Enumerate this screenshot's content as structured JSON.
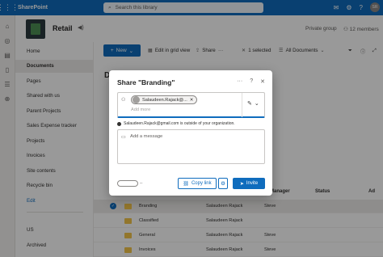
{
  "suite": {
    "app_name": "SharePoint",
    "search_placeholder": "Search this library",
    "avatar_initials": "SR"
  },
  "site": {
    "title": "Retail",
    "group_type": "Private group",
    "members": "12 members"
  },
  "leftnav": {
    "items": [
      {
        "label": "Home"
      },
      {
        "label": "Documents"
      },
      {
        "label": "Pages"
      },
      {
        "label": "Shared with us"
      },
      {
        "label": "Parent Projects"
      },
      {
        "label": "Sales Expense tracker"
      },
      {
        "label": "Projects"
      },
      {
        "label": "Invoices"
      },
      {
        "label": "Site contents"
      },
      {
        "label": "Recycle bin"
      },
      {
        "label": "Edit"
      },
      {
        "label": "US"
      },
      {
        "label": "Archived"
      }
    ],
    "active": "Documents"
  },
  "commandbar": {
    "new_label": "New",
    "edit_grid": "Edit in grid view",
    "share": "Share",
    "selected": "1 selected",
    "view": "All Documents"
  },
  "library": {
    "title_fragment": "D",
    "columns": {
      "manager": "ct Manager",
      "status": "Status",
      "ad": "Ad"
    },
    "rows": [
      {
        "name": "Branding",
        "modified_by": "Salaudeen Rajack",
        "manager": "Steve",
        "selected": true
      },
      {
        "name": "Classified",
        "modified_by": "Salaudeen Rajack",
        "manager": "",
        "selected": false
      },
      {
        "name": "General",
        "modified_by": "Salaudeen Rajack",
        "manager": "Steve",
        "selected": false
      },
      {
        "name": "Invoices",
        "modified_by": "Salaudeen Rajack",
        "manager": "Steve",
        "selected": false
      }
    ]
  },
  "share_dialog": {
    "title": "Share \"Branding\"",
    "recipient": "Salaudeen.Rajack@...",
    "add_more_placeholder": "Add more",
    "warning": "Salaudeen.Rajack@gmail.com is outside of your organization.",
    "message_placeholder": "Add a message",
    "copy_link": "Copy link",
    "invite": "Invite"
  },
  "colors": {
    "accent": "#0f6cbd",
    "folder": "#f3c54a"
  }
}
